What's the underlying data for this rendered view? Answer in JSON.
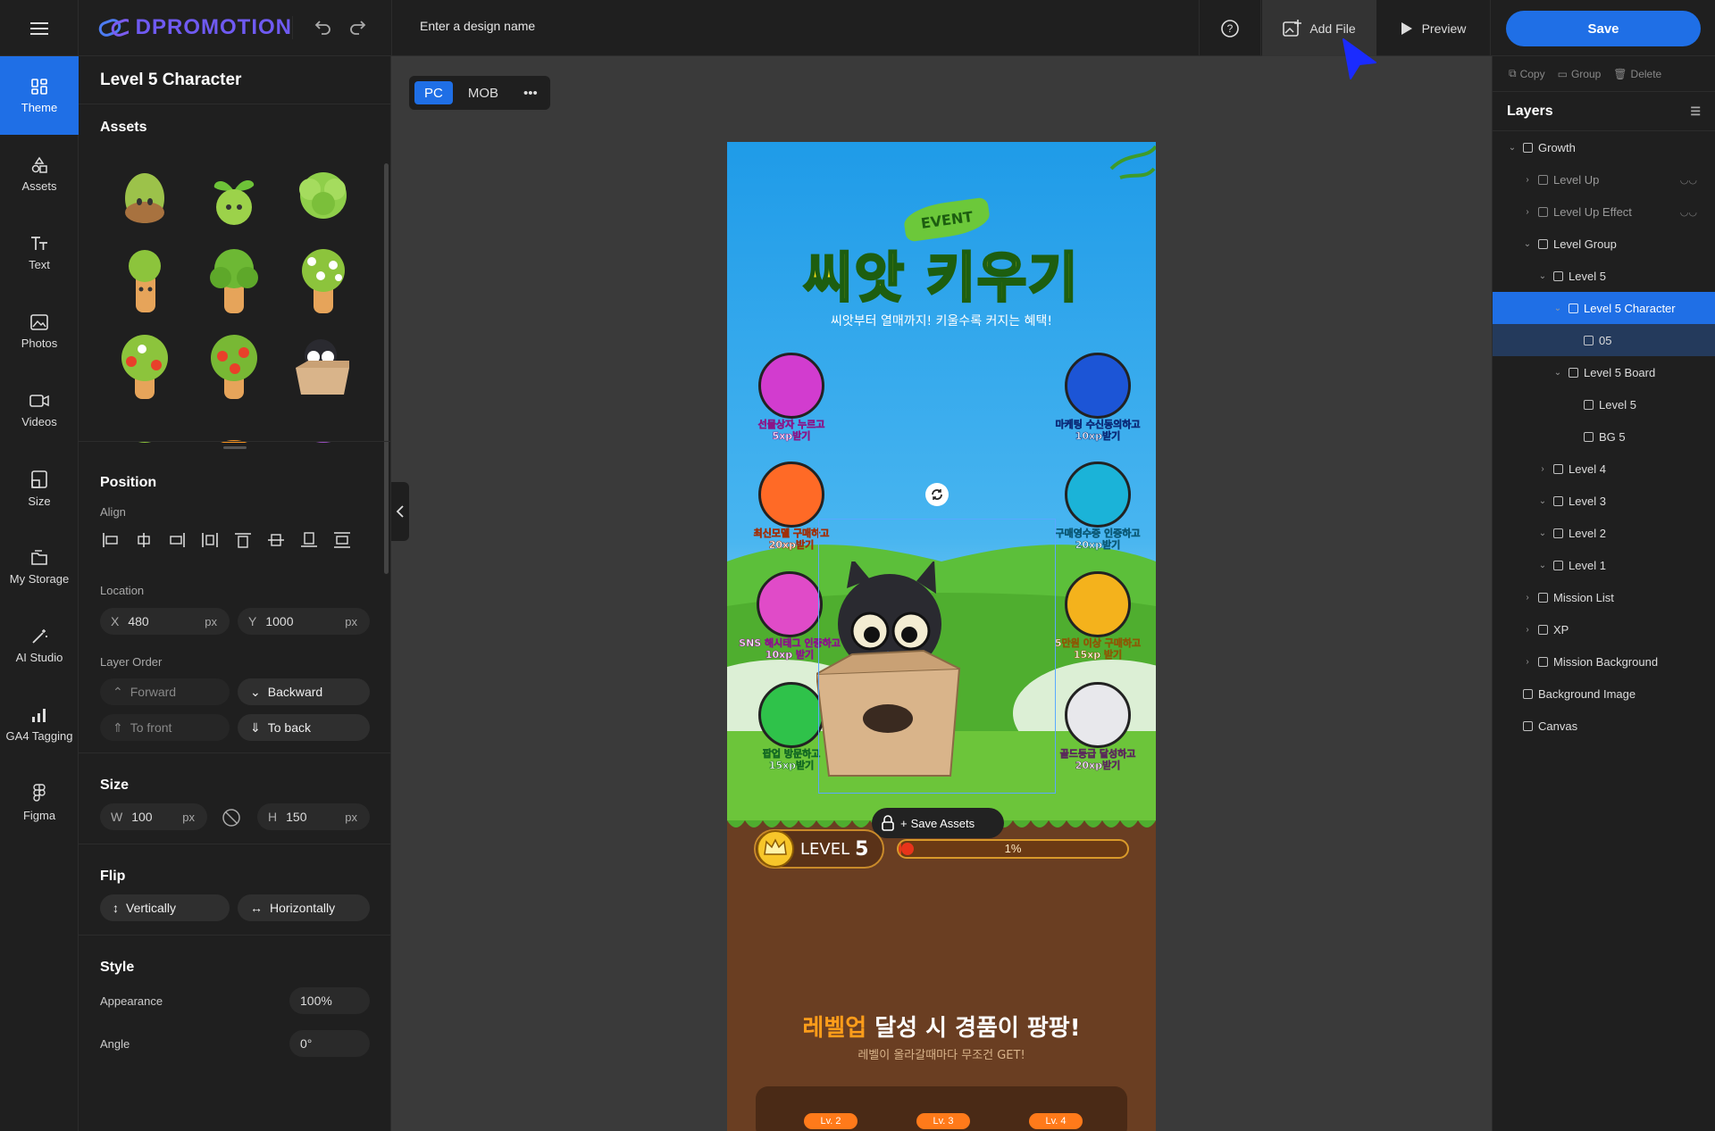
{
  "app": {
    "logo": "DPROMOTION",
    "design_name_placeholder": "Enter a design name",
    "add_file": "Add File",
    "preview": "Preview",
    "save": "Save"
  },
  "rail": [
    {
      "label": "Theme",
      "icon": "theme-icon",
      "active": true
    },
    {
      "label": "Assets",
      "icon": "assets-icon"
    },
    {
      "label": "Text",
      "icon": "text-icon"
    },
    {
      "label": "Photos",
      "icon": "photos-icon"
    },
    {
      "label": "Videos",
      "icon": "videos-icon"
    },
    {
      "label": "Size",
      "icon": "size-icon"
    },
    {
      "label": "My Storage",
      "icon": "storage-icon"
    },
    {
      "label": "AI Studio",
      "icon": "ai-studio-icon"
    },
    {
      "label": "GA4 Tagging",
      "icon": "ga4-icon"
    },
    {
      "label": "Figma",
      "icon": "figma-icon"
    }
  ],
  "panel": {
    "title": "Level 5 Character",
    "assets_heading": "Assets",
    "position_heading": "Position",
    "align_label": "Align",
    "location_label": "Location",
    "x_label": "X",
    "x_value": "480",
    "y_label": "Y",
    "y_value": "1000",
    "unit": "px",
    "layer_order_label": "Layer Order",
    "forward": "Forward",
    "backward": "Backward",
    "to_front": "To front",
    "to_back": "To back",
    "size_heading": "Size",
    "w_label": "W",
    "w_value": "100",
    "h_label": "H",
    "h_value": "150",
    "flip_heading": "Flip",
    "flip_vertical": "Vertically",
    "flip_horizontal": "Horizontally",
    "style_heading": "Style",
    "appearance_label": "Appearance",
    "appearance_value": "100%",
    "angle_label": "Angle",
    "angle_value": "0°"
  },
  "canvas": {
    "pc": "PC",
    "mob": "MOB",
    "event_badge": "EVENT",
    "main_title": "씨앗 키우기",
    "subtitle": "씨앗부터 열매까지! 키울수록 커지는 혜택!",
    "missions": [
      {
        "line1": "선물상자 누르고",
        "line2": "5xp받기",
        "color": "#d23ccf"
      },
      {
        "line1": "마케팅 수신동의하고",
        "line2": "10xp받기",
        "color": "#1c55d6"
      },
      {
        "line1": "최신모델 구매하고",
        "line2": "20xp받기",
        "color": "#ff6a26"
      },
      {
        "line1": "구매영수증 인증하고",
        "line2": "20xp받기",
        "color": "#1bb3d8"
      },
      {
        "line1": "SNS 해시태그 인증하고",
        "line2": "10xp 받기",
        "color": "#e04bc8"
      },
      {
        "line1": "5만원 이상 구매하고",
        "line2": "15xp 받기",
        "color": "#f4b21c"
      },
      {
        "line1": "팝업 방문하고",
        "line2": "15xp받기",
        "color": "#2fc24a"
      },
      {
        "line1": "골드등급 달성하고",
        "line2": "20xp받기",
        "color": "#e8e8ec"
      }
    ],
    "save_assets": "Save Assets",
    "level_label": "LEVEL",
    "level_number": "5",
    "progress_text": "1%",
    "progress_value": 0.01,
    "bottom_title_highlight": "레벨업",
    "bottom_title_rest": " 달성 시 경품이 팡팡!",
    "bottom_subtitle": "레벨이 올라갈때마다 무조건 GET!",
    "level_tabs": [
      "Lv. 2",
      "Lv. 3",
      "Lv. 4"
    ]
  },
  "right": {
    "copy": "Copy",
    "group": "Group",
    "delete": "Delete",
    "layers_heading": "Layers",
    "layers": [
      {
        "name": "Growth",
        "indent": 0,
        "chev": "v",
        "icon": "sparkle-icon"
      },
      {
        "name": "Level Up",
        "indent": 1,
        "chev": ">",
        "icon": "arrow-up-icon",
        "dim": true,
        "hidden": true
      },
      {
        "name": "Level Up Effect",
        "indent": 1,
        "chev": ">",
        "icon": "effect-icon",
        "dim": true,
        "hidden": true
      },
      {
        "name": "Level Group",
        "indent": 1,
        "chev": "v",
        "icon": "group-icon"
      },
      {
        "name": "Level 5",
        "indent": 2,
        "chev": "v",
        "icon": "group-icon"
      },
      {
        "name": "Level 5 Character",
        "indent": 3,
        "chev": "v",
        "icon": "character-icon",
        "selected": true
      },
      {
        "name": "05",
        "indent": 4,
        "chev": "",
        "icon": "image-icon",
        "child": true
      },
      {
        "name": "Level 5 Board",
        "indent": 3,
        "chev": "v",
        "icon": "board-icon"
      },
      {
        "name": "Level 5",
        "indent": 4,
        "chev": "",
        "icon": "text-t-icon"
      },
      {
        "name": "BG 5",
        "indent": 4,
        "chev": "",
        "icon": "image-icon"
      },
      {
        "name": "Level 4",
        "indent": 2,
        "chev": ">",
        "icon": "group-icon"
      },
      {
        "name": "Level 3",
        "indent": 2,
        "chev": "v",
        "icon": "group-icon"
      },
      {
        "name": "Level 2",
        "indent": 2,
        "chev": "v",
        "icon": "group-icon"
      },
      {
        "name": "Level 1",
        "indent": 2,
        "chev": "v",
        "icon": "group-icon"
      },
      {
        "name": "Mission List",
        "indent": 1,
        "chev": ">",
        "icon": "list-icon"
      },
      {
        "name": "XP",
        "indent": 1,
        "chev": ">",
        "icon": "xp-icon"
      },
      {
        "name": "Mission Background",
        "indent": 1,
        "chev": ">",
        "icon": "folder-icon"
      },
      {
        "name": "Background Image",
        "indent": 0,
        "chev": "",
        "icon": "image-icon"
      },
      {
        "name": "Canvas",
        "indent": 0,
        "chev": "",
        "icon": "canvas-icon"
      }
    ]
  },
  "colors": {
    "accent": "#1f6fe6",
    "logo": "#6f5af2",
    "panel_bg": "#1f1f1f",
    "workspace_bg": "#3a3a3a"
  }
}
